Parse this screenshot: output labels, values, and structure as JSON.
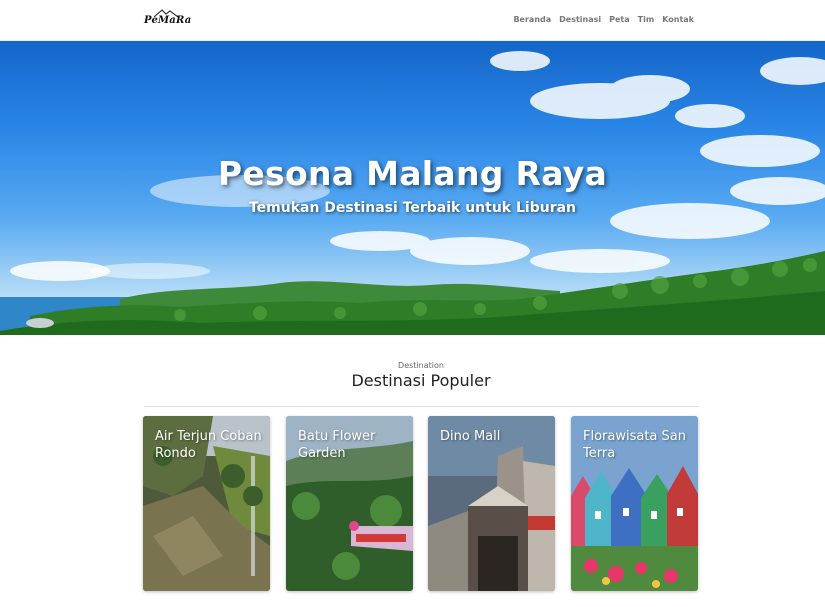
{
  "logo": {
    "text": "PeMaRa",
    "icon": "mountain-logo-icon"
  },
  "nav": {
    "items": [
      {
        "label": "Beranda"
      },
      {
        "label": "Destinasi"
      },
      {
        "label": "Peta"
      },
      {
        "label": "Tim"
      },
      {
        "label": "Kontak"
      }
    ]
  },
  "hero": {
    "title": "Pesona Malang Raya",
    "subtitle": "Temukan Destinasi Terbaik untuk Liburan"
  },
  "section": {
    "tag": "Destination",
    "title": "Destinasi Populer"
  },
  "cards": [
    {
      "title": "Air Terjun Coban Rondo"
    },
    {
      "title": "Batu Flower Garden"
    },
    {
      "title": "Dino Mall"
    },
    {
      "title": "Florawisata San Terra"
    }
  ],
  "colors": {
    "nav_text": "#777777",
    "sky": "#2a86e6",
    "forest": "#2f7d27"
  }
}
